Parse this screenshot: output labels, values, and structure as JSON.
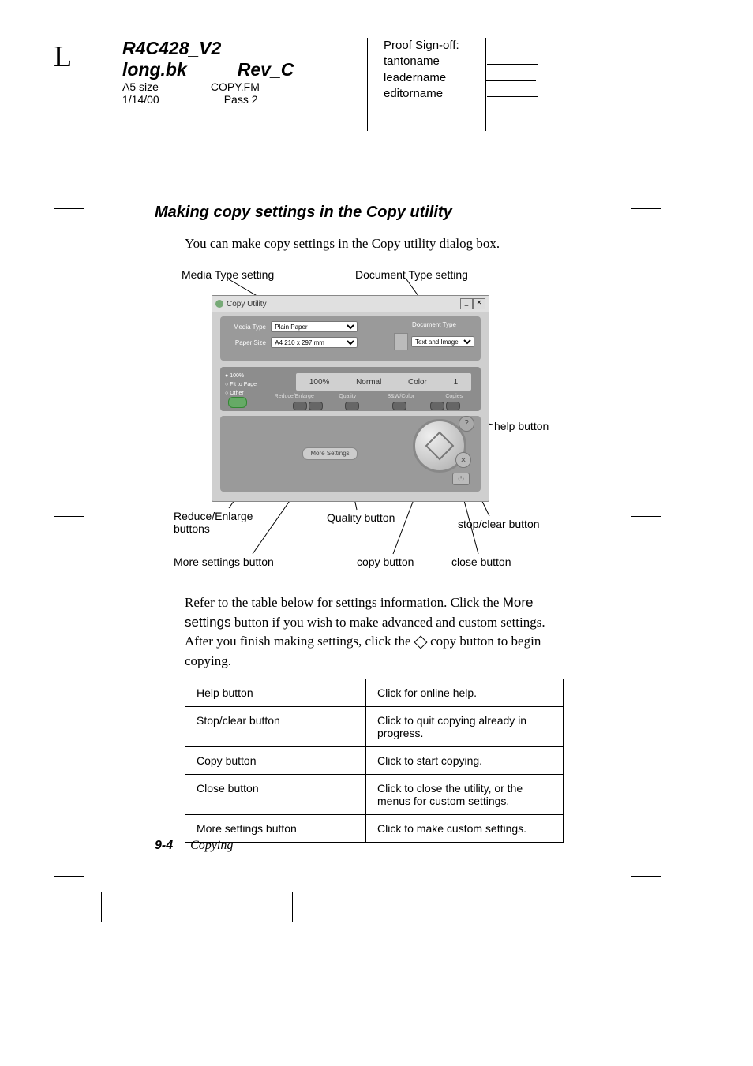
{
  "header": {
    "letter": "L",
    "doc_id": "R4C428_V2",
    "file": "long.bk",
    "rev": "Rev_C",
    "size": "A5 size",
    "fm": "COPY.FM",
    "date": "1/14/00",
    "pass": "Pass 2",
    "proof_label": "Proof Sign-off:",
    "tanto": "tantoname",
    "leader": "leadername",
    "editor": "editorname"
  },
  "section": {
    "title": "Making copy settings in the Copy utility",
    "intro": "You can make copy settings in the Copy utility dialog box.",
    "para2_pre": "Refer to the table below for settings information. Click the ",
    "para2_btn": "More settings",
    "para2_mid": " button if you wish to make advanced and custom settings. After you finish making settings, click the ",
    "para2_post": " copy button to begin copying."
  },
  "diagram": {
    "callout_media": "Media Type setting",
    "callout_doctype": "Document Type setting",
    "callout_help": "help button",
    "callout_reduce": "Reduce/Enlarge buttons",
    "callout_quality": "Quality button",
    "callout_stop": "stop/clear button",
    "callout_more": "More settings button",
    "callout_copy": "copy button",
    "callout_close": "close button",
    "dialog": {
      "window_title": "Copy Utility",
      "media_label": "Media Type",
      "media_value": "Plain Paper",
      "paper_label": "Paper Size",
      "paper_value": "A4 210 x 297 mm",
      "doctype_label": "Document Type",
      "doctype_value": "Text and Image",
      "radio_100": "100%",
      "radio_fit": "Fit to Page",
      "radio_other": "Other",
      "col_reduce": "Reduce/Enlarge",
      "col_quality": "Quality",
      "col_bw": "B&W/Color",
      "col_copies": "Copies",
      "val_scale": "100%",
      "val_quality": "Normal",
      "val_color": "Color",
      "val_copies": "1",
      "more_settings": "More Settings",
      "help_glyph": "?",
      "stop_glyph": "✕",
      "close_glyph": "⏻",
      "min_glyph": "_",
      "x_glyph": "✕"
    }
  },
  "table": {
    "rows": [
      {
        "name": "Help button",
        "desc": "Click for online help."
      },
      {
        "name": "Stop/clear button",
        "desc": "Click to quit copying already in progress."
      },
      {
        "name": "Copy button",
        "desc": "Click to start copying."
      },
      {
        "name": "Close button",
        "desc": "Click to close the utility, or the menus for custom settings."
      },
      {
        "name": "More settings button",
        "desc": "Click to make custom settings."
      }
    ]
  },
  "footer": {
    "page_num": "9-4",
    "chapter": "Copying"
  }
}
